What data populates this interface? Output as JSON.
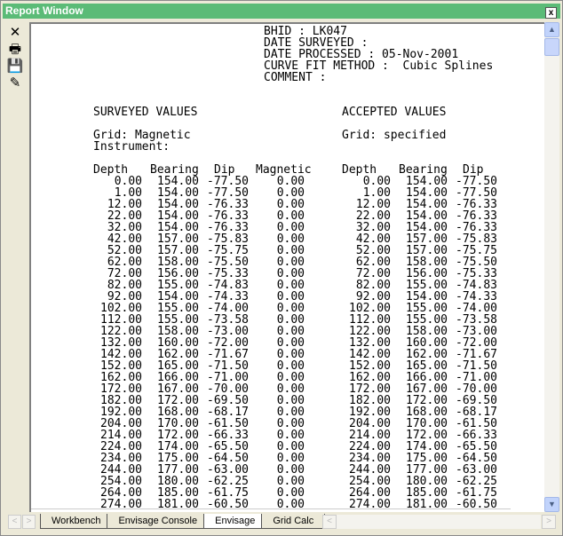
{
  "window": {
    "title": "Report Window",
    "close": "x"
  },
  "toolbar": [
    {
      "name": "close-icon",
      "glyph": "✕"
    },
    {
      "name": "print-icon",
      "glyph": "🖶"
    },
    {
      "name": "save-icon",
      "glyph": "💾"
    },
    {
      "name": "eraser-icon",
      "glyph": "✎"
    }
  ],
  "header": {
    "bhid": "BHID : LK047",
    "surveyed": "DATE SURVEYED :",
    "processed": "DATE PROCESSED : 05-Nov-2001",
    "method": "CURVE FIT METHOD :  Cubic Splines",
    "comment": "COMMENT :"
  },
  "surveyed": {
    "title": "SURVEYED VALUES",
    "grid": "Grid: Magnetic",
    "instrument": "Instrument:",
    "cols": [
      "Depth",
      "Bearing",
      "Dip",
      "Magnetic"
    ]
  },
  "accepted": {
    "title": "ACCEPTED VALUES",
    "grid": "Grid: specified",
    "cols": [
      "Depth",
      "Bearing",
      "Dip"
    ]
  },
  "rows": [
    [
      "0.00",
      "154.00",
      "-77.50",
      "0.00"
    ],
    [
      "1.00",
      "154.00",
      "-77.50",
      "0.00"
    ],
    [
      "12.00",
      "154.00",
      "-76.33",
      "0.00"
    ],
    [
      "22.00",
      "154.00",
      "-76.33",
      "0.00"
    ],
    [
      "32.00",
      "154.00",
      "-76.33",
      "0.00"
    ],
    [
      "42.00",
      "157.00",
      "-75.83",
      "0.00"
    ],
    [
      "52.00",
      "157.00",
      "-75.75",
      "0.00"
    ],
    [
      "62.00",
      "158.00",
      "-75.50",
      "0.00"
    ],
    [
      "72.00",
      "156.00",
      "-75.33",
      "0.00"
    ],
    [
      "82.00",
      "155.00",
      "-74.83",
      "0.00"
    ],
    [
      "92.00",
      "154.00",
      "-74.33",
      "0.00"
    ],
    [
      "102.00",
      "155.00",
      "-74.00",
      "0.00"
    ],
    [
      "112.00",
      "155.00",
      "-73.58",
      "0.00"
    ],
    [
      "122.00",
      "158.00",
      "-73.00",
      "0.00"
    ],
    [
      "132.00",
      "160.00",
      "-72.00",
      "0.00"
    ],
    [
      "142.00",
      "162.00",
      "-71.67",
      "0.00"
    ],
    [
      "152.00",
      "165.00",
      "-71.50",
      "0.00"
    ],
    [
      "162.00",
      "166.00",
      "-71.00",
      "0.00"
    ],
    [
      "172.00",
      "167.00",
      "-70.00",
      "0.00"
    ],
    [
      "182.00",
      "172.00",
      "-69.50",
      "0.00"
    ],
    [
      "192.00",
      "168.00",
      "-68.17",
      "0.00"
    ],
    [
      "204.00",
      "170.00",
      "-61.50",
      "0.00"
    ],
    [
      "214.00",
      "172.00",
      "-66.33",
      "0.00"
    ],
    [
      "224.00",
      "174.00",
      "-65.50",
      "0.00"
    ],
    [
      "234.00",
      "175.00",
      "-64.50",
      "0.00"
    ],
    [
      "244.00",
      "177.00",
      "-63.00",
      "0.00"
    ],
    [
      "254.00",
      "180.00",
      "-62.25",
      "0.00"
    ],
    [
      "264.00",
      "185.00",
      "-61.75",
      "0.00"
    ],
    [
      "274.00",
      "181.00",
      "-60.50",
      "0.00"
    ]
  ],
  "tabs": [
    {
      "label": "Workbench",
      "active": false
    },
    {
      "label": "Envisage Console",
      "active": false
    },
    {
      "label": "Envisage",
      "active": true
    },
    {
      "label": "Grid Calc",
      "active": false
    }
  ]
}
